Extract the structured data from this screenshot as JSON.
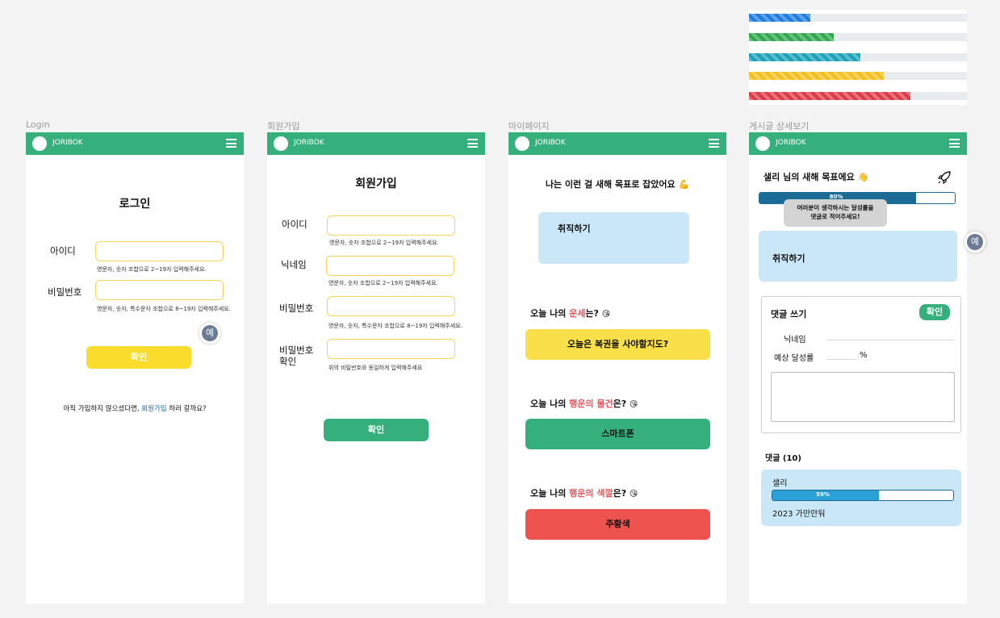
{
  "app": {
    "brand": "JORIBOK"
  },
  "progress_bars": [
    {
      "value": 0.28,
      "color": "#1f7de0"
    },
    {
      "value": 0.39,
      "color": "#30a84e"
    },
    {
      "value": 0.51,
      "color": "#1ba2b8"
    },
    {
      "value": 0.62,
      "color": "#f2c01f"
    },
    {
      "value": 0.74,
      "color": "#dc3b48"
    }
  ],
  "frames": {
    "login": {
      "frame_label": "Login",
      "title": "로그인",
      "id_label": "아이디",
      "id_hint": "영문자, 숫자 조합으로 2~19자 입력해주세요.",
      "pw_label": "비밀번호",
      "pw_hint": "영문자, 숫자, 특수문자 조합으로 8~19자 입력해주세요.",
      "confirm": "확인",
      "signup_prompt_before": "아직 가입하지 않으셨다면, ",
      "signup_link": "회원가입",
      "signup_prompt_after": " 하러 갈까요?"
    },
    "signup": {
      "frame_label": "회원가입",
      "title": "회원가입",
      "id_label": "아이디",
      "id_hint": "영문자, 숫자 조합으로 2~19자 입력해주세요.",
      "nick_label": "닉네임",
      "nick_hint": "영문자, 숫자 조합으로 2~19자 입력해주세요.",
      "pw_label": "비밀번호",
      "pw_hint": "영문자, 숫자, 특수문자 조합으로 8~19자 입력해주세요.",
      "pw_confirm_label_1": "비밀번호",
      "pw_confirm_label_2": "확인",
      "pw_confirm_hint": "위의 비밀번호와 동일하게 입력해주세요",
      "confirm": "확인"
    },
    "mypage": {
      "frame_label": "마이페이지",
      "goal_heading": "나는 이런 걸 새해 목표로 잡았어요 💪",
      "goal_text": "취직하기",
      "fortune_q_before": "오늘 나의 ",
      "fortune_q_hl": "운세",
      "fortune_q_after": "는? ",
      "fortune_answer": "오늘은 복권을 사야할지도?",
      "lucky_item_q_before": "오늘 나의 ",
      "lucky_item_q_hl": "행운의 물건",
      "lucky_item_q_after": "은? ",
      "lucky_item_answer": "스마트폰",
      "lucky_color_q_before": "오늘 나의 ",
      "lucky_color_q_hl": "행운의 색깔",
      "lucky_color_q_after": "은? ",
      "lucky_color_answer": "주황색",
      "emoji": "😘"
    },
    "post": {
      "frame_label": "게시글 상세보기",
      "title": "샐리 님의 새해 목표에요 👋",
      "progress_label": "80%",
      "progress_value": 0.8,
      "tooltip_line1": "여러분이 생각하시는 달성률을",
      "tooltip_line2": "댓글로 적어주세요!",
      "goal_text": "취직하기",
      "comment_write_title": "댓글 쓰기",
      "comment_confirm": "확인",
      "nick_label": "닉네임",
      "rate_label": "예상 달성률",
      "rate_unit": "%",
      "comments_title": "댓글 (10)",
      "comments": [
        {
          "author": "샐리",
          "rate_label": "59%",
          "rate_value": 0.59,
          "text": "2023 가만안둬"
        }
      ]
    }
  },
  "fab_label": "예",
  "colors": {
    "primary": "#35b07d",
    "yellow": "#f9dc2c",
    "red": "#ef5350",
    "light_blue": "#c9e7f7",
    "dark_blue": "#1c6a96"
  }
}
